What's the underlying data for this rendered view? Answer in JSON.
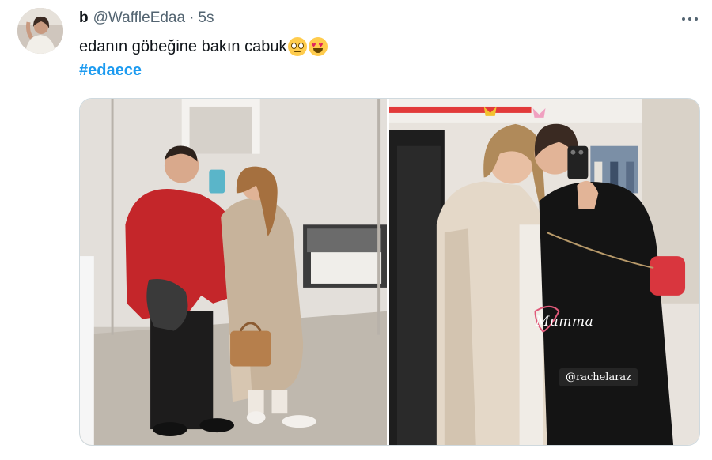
{
  "tweet": {
    "display_name": "b",
    "handle": "@WaffleEdaa",
    "separator": "·",
    "time": "5s",
    "text": "edanın göbeğine bakın cabuk",
    "emojis": [
      "pleading-face",
      "heart-eyes-face"
    ],
    "hashtag": "#edaece"
  },
  "media": {
    "photos": [
      {
        "label": "mirror-selfie-photo"
      },
      {
        "label": "store-selfie-photo",
        "overlay_script": "Mumma",
        "overlay_tag": "@rachelaraz"
      }
    ]
  },
  "colors": {
    "link": "#1d9bf0",
    "secondary_text": "#536471",
    "border": "#cfd9de"
  }
}
